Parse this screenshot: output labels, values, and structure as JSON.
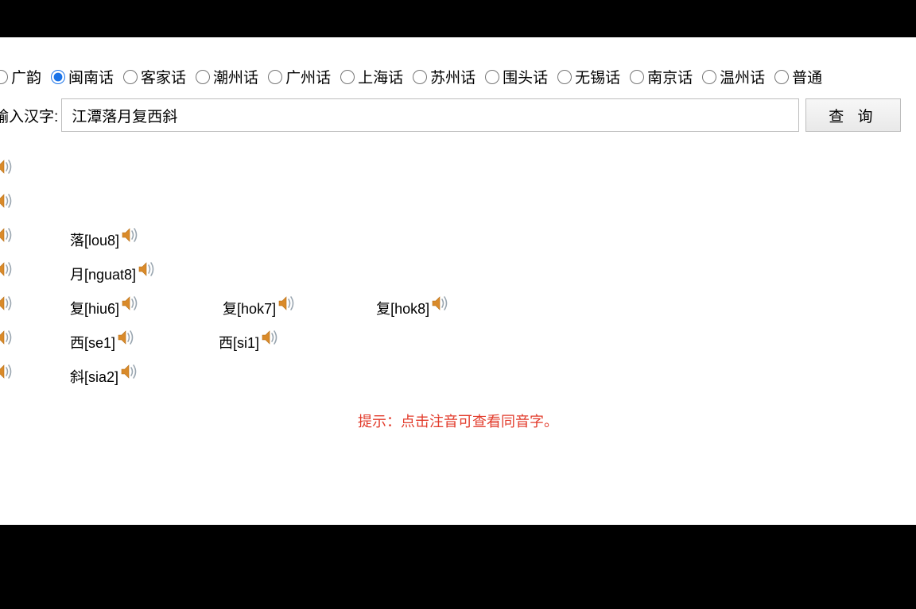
{
  "dialects": [
    {
      "id": "guangyun",
      "label": "广韵",
      "checked": false
    },
    {
      "id": "minnan",
      "label": "闽南话",
      "checked": true
    },
    {
      "id": "hakka",
      "label": "客家话",
      "checked": false
    },
    {
      "id": "chaozhou",
      "label": "潮州话",
      "checked": false
    },
    {
      "id": "guangzhou",
      "label": "广州话",
      "checked": false
    },
    {
      "id": "shanghai",
      "label": "上海话",
      "checked": false
    },
    {
      "id": "suzhou",
      "label": "苏州话",
      "checked": false
    },
    {
      "id": "weitou",
      "label": "围头话",
      "checked": false
    },
    {
      "id": "wuxi",
      "label": "无锡话",
      "checked": false
    },
    {
      "id": "nanjing",
      "label": "南京话",
      "checked": false
    },
    {
      "id": "wenzhou",
      "label": "温州话",
      "checked": false
    },
    {
      "id": "putong",
      "label": "普通",
      "checked": false
    }
  ],
  "search": {
    "label": "输入汉字:",
    "value": "江潭落月复西斜",
    "button": "查 询"
  },
  "rows": [
    {
      "left_reading": "",
      "entries": []
    },
    {
      "left_reading": "",
      "entries": []
    },
    {
      "left_reading": "",
      "entries": [
        {
          "text": "落[lou8]"
        }
      ]
    },
    {
      "left_reading": "",
      "entries": [
        {
          "text": "月[nguat8]"
        }
      ]
    },
    {
      "left_reading": "",
      "entries": [
        {
          "text": "复[hiu6]"
        },
        {
          "text": "复[hok7]"
        },
        {
          "text": "复[hok8]"
        }
      ]
    },
    {
      "left_reading": "",
      "entries": [
        {
          "text": "西[se1]"
        },
        {
          "text": "西[si1]"
        }
      ]
    },
    {
      "left_reading": "",
      "entries": [
        {
          "text": "斜[sia2]"
        }
      ]
    }
  ],
  "tip": "提示：点击注音可查看同音字。"
}
